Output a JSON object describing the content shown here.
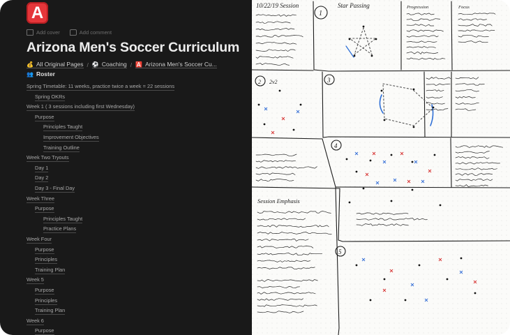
{
  "page": {
    "icon_letter": "A",
    "add_cover": "Add cover",
    "add_comment": "Add comment",
    "title": "Arizona Men's Soccer Curriculum"
  },
  "breadcrumbs": [
    {
      "emoji": "💰",
      "label": "All Original Pages"
    },
    {
      "emoji": "⚽",
      "label": "Coaching"
    },
    {
      "emoji": "🅰️",
      "label": "Arizona Men's Soccer Cu..."
    }
  ],
  "roster": {
    "emoji": "👥",
    "label": "Roster"
  },
  "toc": [
    {
      "label": "Spring Timetable: 11 weeks, practice twice a week = 22 sessions",
      "level": 0
    },
    {
      "label": "Spring OKRs",
      "level": 1
    },
    {
      "label": "Week 1 ( 3 sessions including first Wednesday)",
      "level": 0
    },
    {
      "label": "Purpose",
      "level": 1
    },
    {
      "label": "Principles Taught",
      "level": 2
    },
    {
      "label": "Improvement Objectives",
      "level": 2
    },
    {
      "label": "Training Outline",
      "level": 2
    },
    {
      "label": "Week Two Tryouts",
      "level": 0
    },
    {
      "label": "Day 1",
      "level": 1
    },
    {
      "label": "Day 2",
      "level": 1
    },
    {
      "label": "Day 3 - Final Day",
      "level": 1
    },
    {
      "label": "Week Three",
      "level": 0
    },
    {
      "label": "Purpose",
      "level": 1
    },
    {
      "label": "Principles Taught",
      "level": 2
    },
    {
      "label": "Practice Plans",
      "level": 2
    },
    {
      "label": "Week Four",
      "level": 0
    },
    {
      "label": "Purpose",
      "level": 1
    },
    {
      "label": "Principles",
      "level": 1
    },
    {
      "label": "Training Plan",
      "level": 1
    },
    {
      "label": "Week 5",
      "level": 0
    },
    {
      "label": "Purpose",
      "level": 1
    },
    {
      "label": "Principles",
      "level": 1
    },
    {
      "label": "Training Plan",
      "level": 1
    },
    {
      "label": "Week 6",
      "level": 0
    },
    {
      "label": "Purpose",
      "level": 1
    }
  ],
  "sketch": {
    "header_date": "10/22/19 Session",
    "box_numbers": [
      "1",
      "2",
      "3",
      "4",
      "5"
    ],
    "box1_title": "Star Passing",
    "box2_title": "2v2",
    "session_emphasis": "Session Emphasis",
    "progression_label": "Progression",
    "focus_label": "Focus"
  }
}
